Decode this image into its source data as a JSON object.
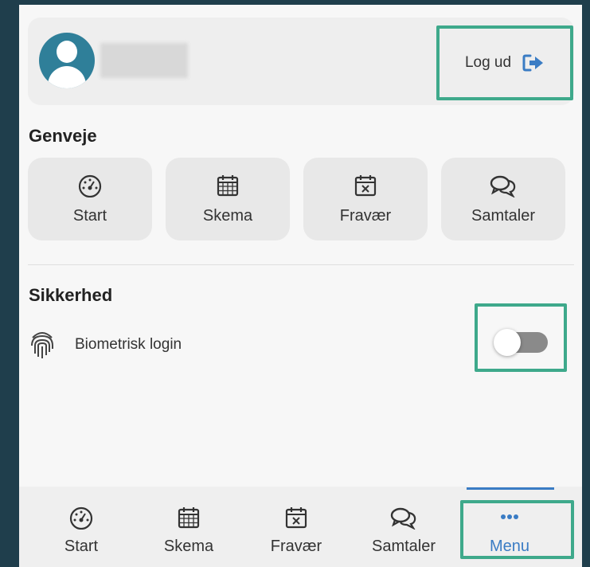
{
  "header": {
    "logout_label": "Log ud"
  },
  "shortcuts": {
    "title": "Genveje",
    "items": [
      {
        "label": "Start",
        "icon": "dashboard-icon"
      },
      {
        "label": "Skema",
        "icon": "calendar-icon"
      },
      {
        "label": "Fravær",
        "icon": "calendar-x-icon"
      },
      {
        "label": "Samtaler",
        "icon": "chat-bubbles-icon"
      }
    ]
  },
  "security": {
    "title": "Sikkerhed",
    "biometric_label": "Biometrisk login",
    "biometric_enabled": false
  },
  "bottom_nav": {
    "items": [
      {
        "label": "Start",
        "icon": "dashboard-icon"
      },
      {
        "label": "Skema",
        "icon": "calendar-icon"
      },
      {
        "label": "Fravær",
        "icon": "calendar-x-icon"
      },
      {
        "label": "Samtaler",
        "icon": "chat-bubbles-icon"
      },
      {
        "label": "Menu",
        "icon": "more-dots-icon",
        "active": true
      }
    ]
  },
  "colors": {
    "accent": "#3a7cc4",
    "highlight_box": "#3ea98b",
    "avatar": "#2f7f99"
  }
}
